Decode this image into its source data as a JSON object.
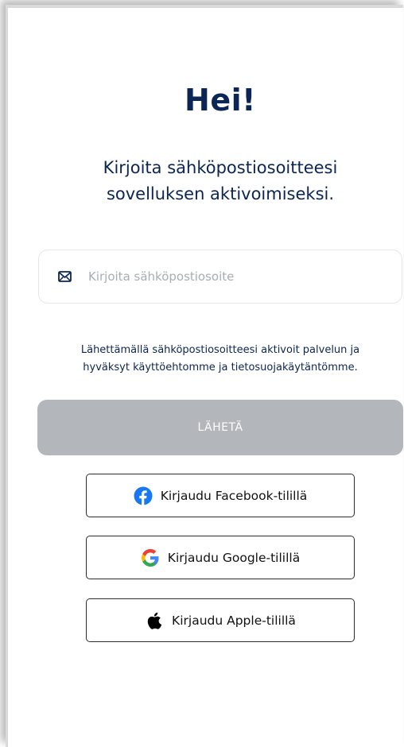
{
  "greeting": "Hei!",
  "subtitle_line1": "Kirjoita sähköpostiosoitteesi",
  "subtitle_line2": "sovelluksen aktivoimiseksi.",
  "email_field": {
    "placeholder": "Kirjoita sähköpostiosoite",
    "value": "",
    "icon": "mail-icon"
  },
  "terms_line1": "Lähettämällä sähköpostiosoitteesi aktivoit palvelun ja",
  "terms_line2": "hyväksyt käyttöehtomme ja tietosuojakäytäntömme.",
  "send_button": "LÄHETÄ",
  "social": {
    "facebook": {
      "label": "Kirjaudu Facebook-tilillä",
      "icon": "facebook-icon",
      "color": "#1877f2"
    },
    "google": {
      "label": "Kirjaudu Google-tilillä",
      "icon": "google-icon"
    },
    "apple": {
      "label": "Kirjaudu Apple-tilillä",
      "icon": "apple-icon",
      "color": "#000000"
    }
  },
  "colors": {
    "heading": "#0b2654",
    "button_disabled": "#b3b6bb",
    "border": "#2b2b2b"
  }
}
